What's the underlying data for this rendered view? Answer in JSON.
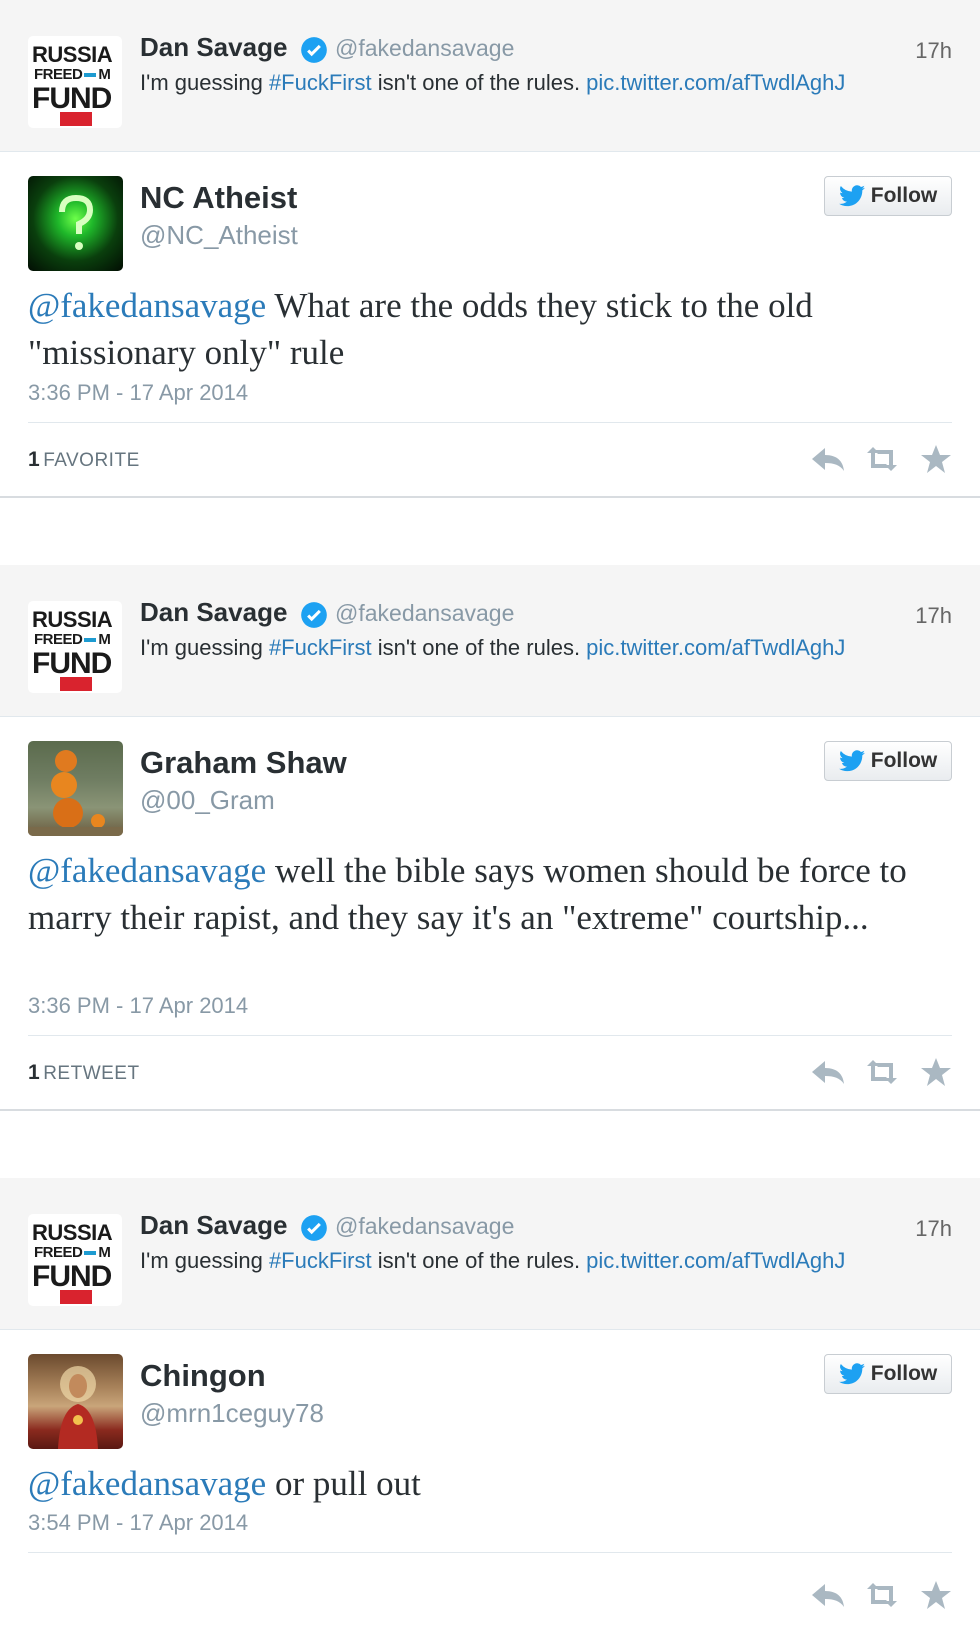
{
  "parent_tweet": {
    "name": "Dan Savage",
    "handle": "@fakedansavage",
    "time": "17h",
    "text_before": "I'm guessing ",
    "hashtag": "#FuckFirst",
    "text_after": " isn't one of the rules. ",
    "link": "pic.twitter.com/afTwdlAghJ",
    "avatar_lines": [
      "RUSSIA",
      "FREED",
      "M",
      "FUND"
    ]
  },
  "follow_label": "Follow",
  "replies": [
    {
      "name": "NC Atheist",
      "handle": "@NC_Atheist",
      "mention": "@fakedansavage",
      "text": " What are the odds they stick to the old \"missionary only\" rule",
      "date": "3:36 PM - 17 Apr 2014",
      "stat_count": "1",
      "stat_label": "FAVORITE"
    },
    {
      "name": "Graham Shaw",
      "handle": "@00_Gram",
      "mention": "@fakedansavage",
      "text": " well the bible says women should be force to marry their rapist, and they say it's an \"extreme\" courtship...",
      "date": "3:36 PM - 17 Apr 2014",
      "stat_count": "1",
      "stat_label": "RETWEET"
    },
    {
      "name": "Chingon",
      "handle": "@mrn1ceguy78",
      "mention": "@fakedansavage",
      "text": " or pull out",
      "date": "3:54 PM - 17 Apr 2014",
      "stat_count": "",
      "stat_label": ""
    }
  ],
  "icons": {
    "verified": "verified-badge-icon",
    "twitter_bird": "twitter-bird-icon",
    "reply": "reply-icon",
    "retweet": "retweet-icon",
    "favorite": "star-icon"
  },
  "colors": {
    "link": "#2b7bb9",
    "verified": "#1da1f2",
    "muted": "#8899a6",
    "action_icon": "#aab8c2"
  }
}
